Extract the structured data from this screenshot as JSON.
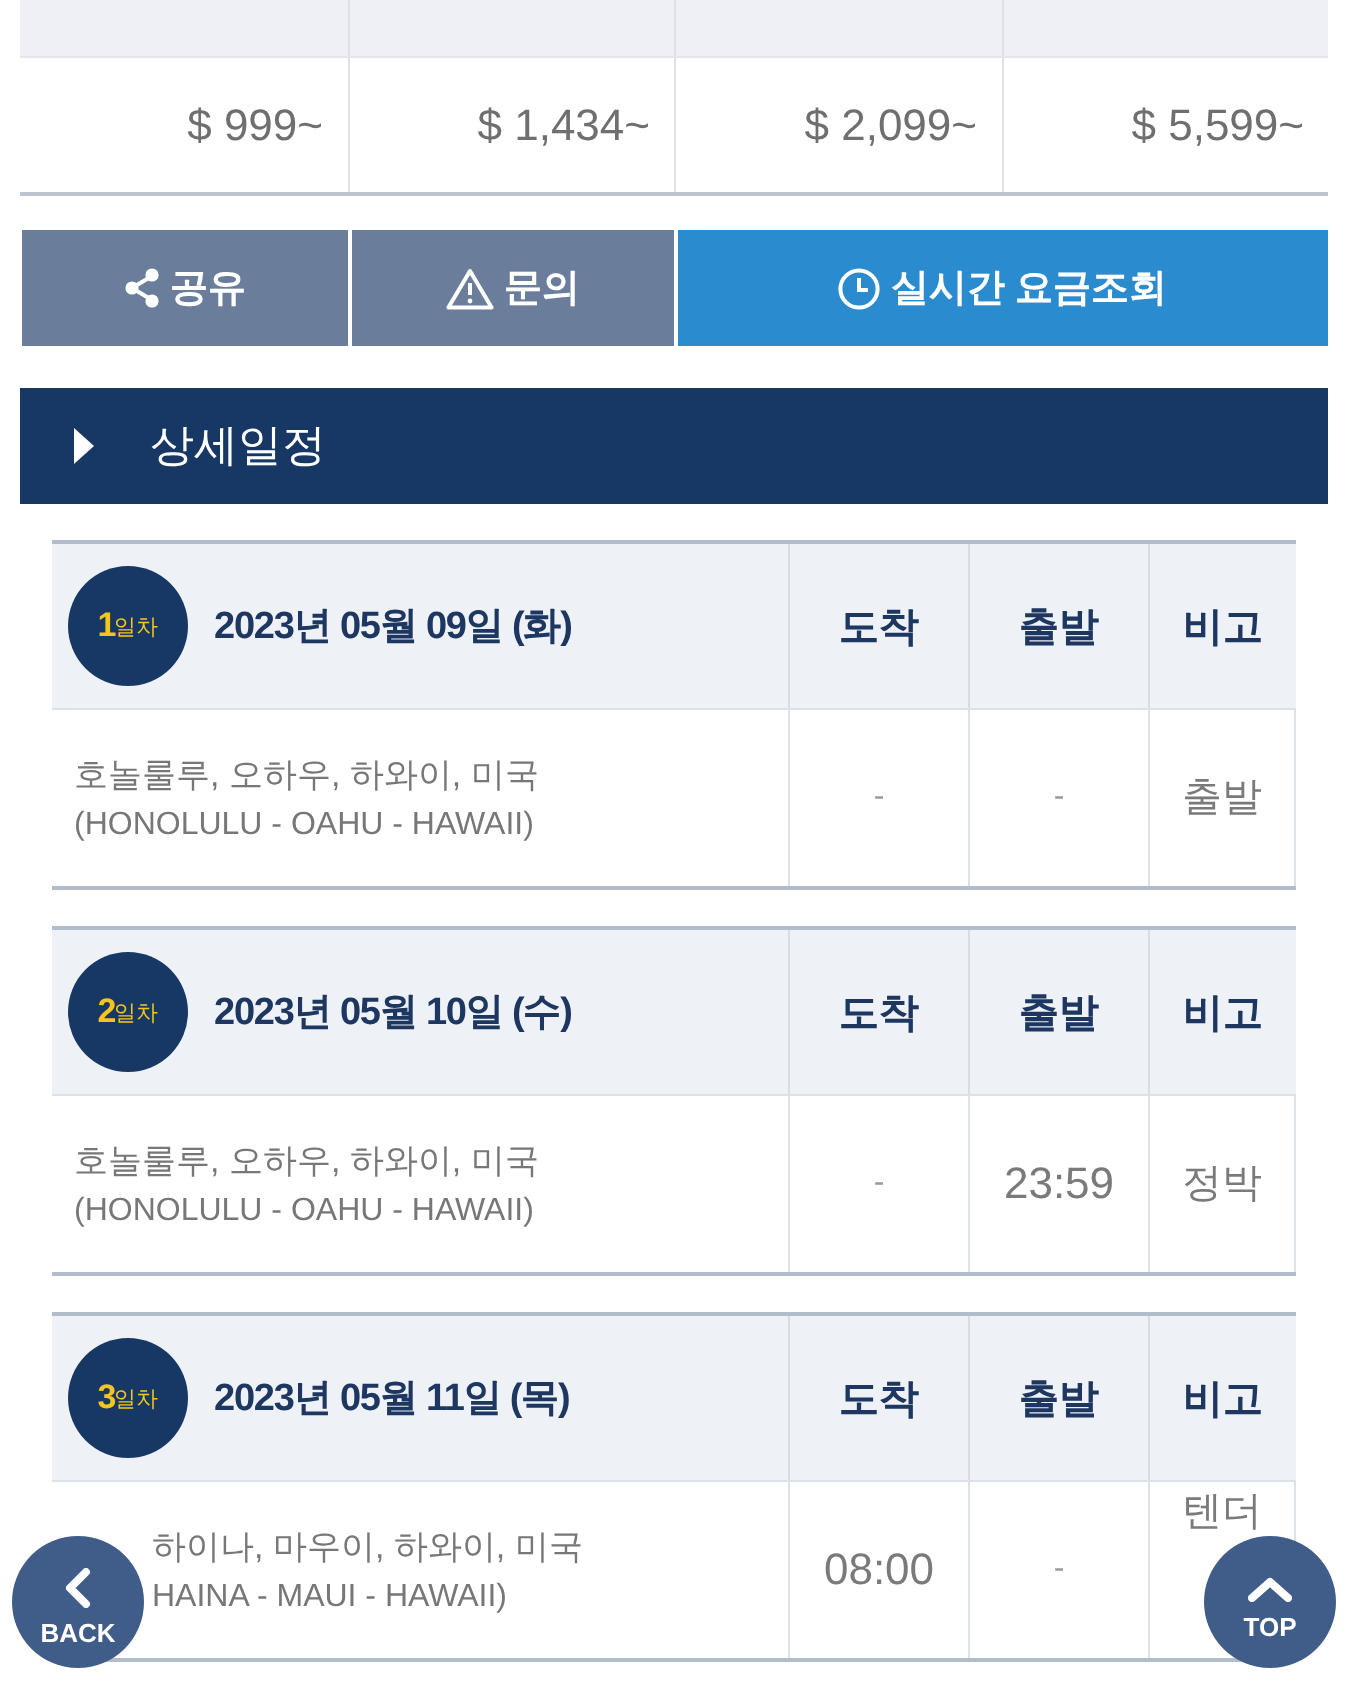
{
  "price_table": {
    "prices": [
      "$ 999~",
      "$ 1,434~",
      "$ 2,099~",
      "$ 5,599~"
    ]
  },
  "actions": [
    {
      "kind": "share",
      "label": "공유"
    },
    {
      "kind": "inquiry",
      "label": "문의"
    },
    {
      "kind": "fare",
      "label": "실시간 요금조회"
    }
  ],
  "section": {
    "title": "상세일정"
  },
  "itinerary": [
    {
      "badge": {
        "number": "1",
        "unit": "일차"
      },
      "date": "2023년 05월 09일 (화)",
      "columns": [
        "도착",
        "출발",
        "비고"
      ],
      "port": {
        "name": "호놀룰루, 오하우, 하와이, 미국",
        "name_en": "(HONOLULU - OAHU - HAWAII)"
      },
      "arrival": "-",
      "departure": "-",
      "note": "출발"
    },
    {
      "badge": {
        "number": "2",
        "unit": "일차"
      },
      "date": "2023년 05월 10일 (수)",
      "columns": [
        "도착",
        "출발",
        "비고"
      ],
      "port": {
        "name": "호놀룰루, 오하우, 하와이, 미국",
        "name_en": "(HONOLULU - OAHU - HAWAII)"
      },
      "arrival": "-",
      "departure": "23:59",
      "note": "정박"
    },
    {
      "badge": {
        "number": "3",
        "unit": "일차"
      },
      "date": "2023년 05월 11일 (목)",
      "columns": [
        "도착",
        "출발",
        "비고"
      ],
      "port": {
        "name": "하이나, 마우이, 하와이, 미국",
        "name_en": "HAINA - MAUI - HAWAII)"
      },
      "arrival": "08:00",
      "departure": "-",
      "note": "텐더"
    }
  ],
  "floating_buttons": [
    {
      "kind": "back",
      "label": "BACK"
    },
    {
      "kind": "top",
      "label": "TOP"
    }
  ]
}
